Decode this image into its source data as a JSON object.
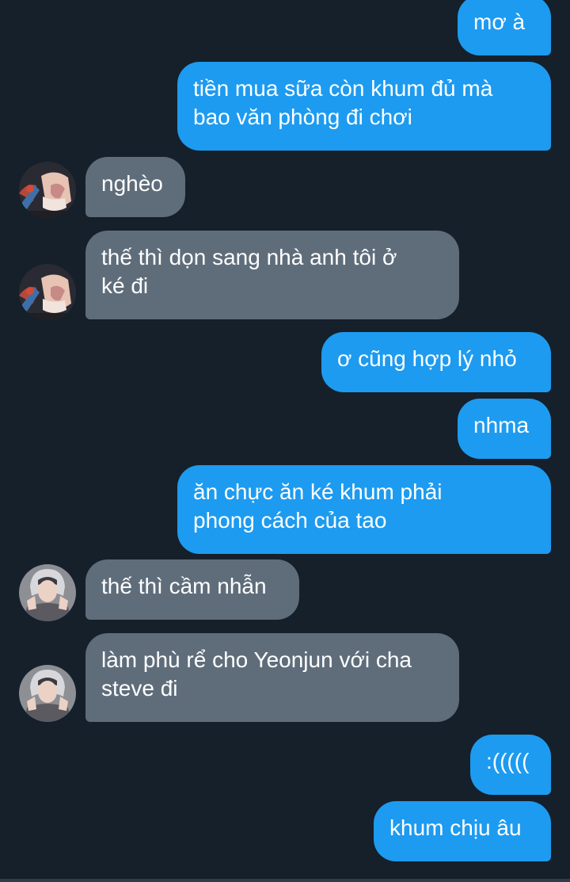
{
  "messages": [
    {
      "direction": "out",
      "text": "mơ à"
    },
    {
      "direction": "out",
      "text": "tiền mua sữa còn khum đủ mà\nbao văn phòng đi chơi"
    },
    {
      "direction": "in",
      "sender_avatar": "anime-cartoon-avatar",
      "text": "nghèo"
    },
    {
      "direction": "in",
      "sender_avatar": "anime-cartoon-avatar",
      "text": "thế thì dọn sang nhà anh tôi ở\nké đi"
    },
    {
      "direction": "out",
      "text": "ơ cũng hợp lý nhỏ"
    },
    {
      "direction": "out",
      "text": "nhma"
    },
    {
      "direction": "out",
      "text": "ăn chực ăn ké khum phải\nphong cách của tao"
    },
    {
      "direction": "in",
      "sender_avatar": "person-photo-avatar",
      "text": "thế thì cầm nhẫn"
    },
    {
      "direction": "in",
      "sender_avatar": "person-photo-avatar",
      "text": "làm phù rể cho Yeonjun với cha\nsteve đi"
    },
    {
      "direction": "out",
      "text": ":((((("
    },
    {
      "direction": "out",
      "text": "khum chịu âu"
    }
  ],
  "colors": {
    "background": "#15202b",
    "outgoing_bubble": "#1d9bf0",
    "incoming_bubble": "#5f6d7b",
    "text": "#ffffff"
  }
}
